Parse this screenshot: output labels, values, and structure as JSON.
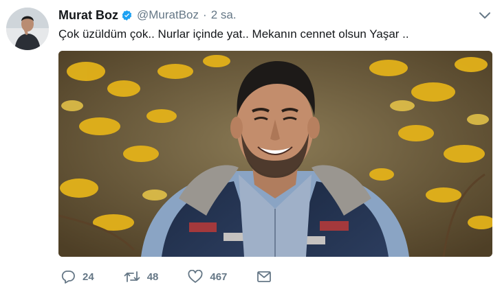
{
  "author": {
    "name": "Murat Boz",
    "handle": "@MuratBoz",
    "separator": "·",
    "time": "2 sa."
  },
  "tweet": {
    "text": "Çok üzüldüm çok.. Nurlar içinde yat.. Mekanın cennet olsun Yaşar .."
  },
  "actions": {
    "replies": "24",
    "retweets": "48",
    "likes": "467"
  },
  "icons": {
    "verified": "verified-badge-icon",
    "caret": "chevron-down-icon",
    "reply": "reply-icon",
    "retweet": "retweet-icon",
    "like": "heart-icon",
    "message": "direct-message-icon"
  },
  "colors": {
    "text": "#14171a",
    "secondary": "#657786",
    "verified": "#1da1f2"
  }
}
